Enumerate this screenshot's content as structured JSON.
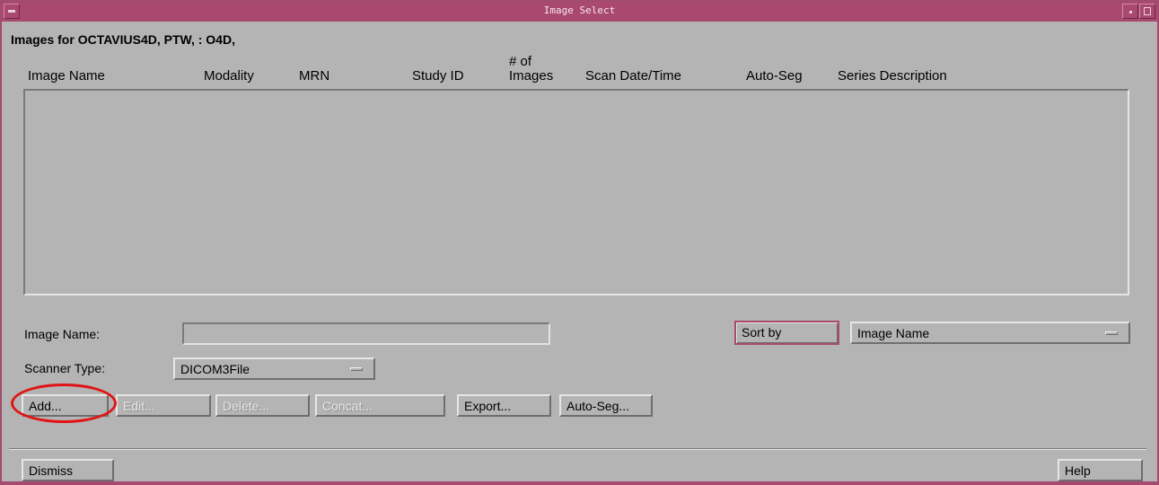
{
  "window": {
    "title": "Image Select"
  },
  "header": {
    "label": "Images for OCTAVIUS4D, PTW, : O4D,"
  },
  "table": {
    "columns": {
      "image_name": "Image Name",
      "modality": "Modality",
      "mrn": "MRN",
      "study_id": "Study ID",
      "num_images_line1": "# of",
      "num_images_line2": "Images",
      "scan_date": "Scan Date/Time",
      "auto_seg": "Auto-Seg",
      "series_description": "Series Description"
    },
    "rows": []
  },
  "form": {
    "image_name_label": "Image Name:",
    "image_name_value": "",
    "scanner_type_label": "Scanner Type:",
    "scanner_type_value": "DICOM3File",
    "sort_by_label": "Sort by",
    "sort_by_value": "Image Name"
  },
  "actions": {
    "add": "Add...",
    "edit": "Edit...",
    "delete": "Delete...",
    "concat": "Concat...",
    "export": "Export...",
    "auto_seg": "Auto-Seg..."
  },
  "footer": {
    "dismiss": "Dismiss",
    "help": "Help"
  },
  "colors": {
    "titlebar": "#a9496f",
    "background": "#b4b4b4",
    "highlight": "#e01414"
  }
}
